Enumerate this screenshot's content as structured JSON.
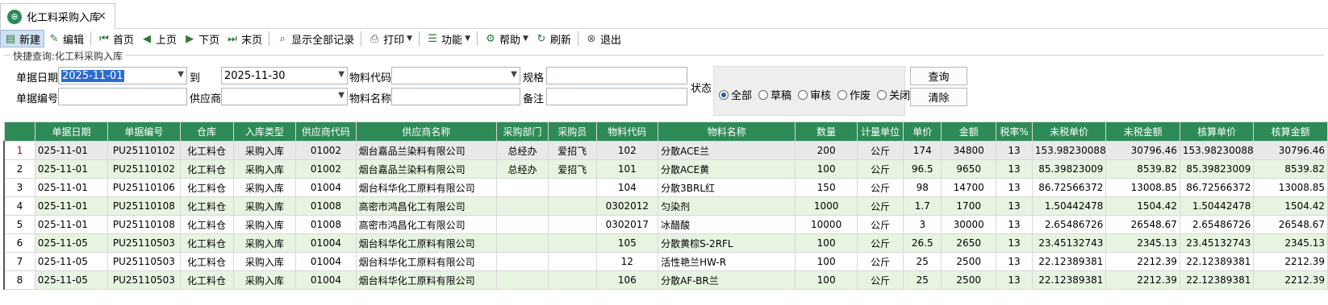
{
  "tab": {
    "title": "化工料采购入库",
    "close": "×"
  },
  "toolbar": {
    "new": "新建",
    "edit": "编辑",
    "first": "首页",
    "prev": "上页",
    "next": "下页",
    "last": "末页",
    "show_all": "显示全部记录",
    "print": "打印",
    "functions": "功能",
    "help": "帮助",
    "refresh": "刷新",
    "exit": "退出"
  },
  "query": {
    "group_title": "快捷查询:化工料采购入库",
    "date_label": "单据日期",
    "date_from": "2025-11-01",
    "to_label": "到",
    "date_to": "2025-11-30",
    "material_code_label": "物料代码",
    "spec_label": "规格",
    "doc_no_label": "单据编号",
    "supplier_label": "供应商",
    "material_name_label": "物料名称",
    "remark_label": "备注",
    "status_label": "状态",
    "status_options": [
      "全部",
      "草稿",
      "审核",
      "作废",
      "关闭"
    ],
    "status_selected": "全部",
    "query_button": "查询",
    "clear_button": "清除"
  },
  "grid": {
    "columns": [
      "单据日期",
      "单据编号",
      "仓库",
      "入库类型",
      "供应商代码",
      "供应商名称",
      "采购部门",
      "采购员",
      "物料代码",
      "物料名称",
      "数量",
      "计量单位",
      "单价",
      "金额",
      "税率%",
      "未税单价",
      "未税金额",
      "核算单价",
      "核算金额"
    ],
    "rows": [
      {
        "n": "1",
        "cells": [
          "025-11-01",
          "PU25110102",
          "化工料仓",
          "采购入库",
          "01002",
          "烟台嘉品兰染料有限公司",
          "总经办",
          "爱招飞",
          "102",
          "分散ACE兰",
          "200",
          "公斤",
          "174",
          "34800",
          "13",
          "153.98230088",
          "30796.46",
          "153.98230088",
          "30796.46"
        ]
      },
      {
        "n": "2",
        "cells": [
          "025-11-01",
          "PU25110102",
          "化工料仓",
          "采购入库",
          "01002",
          "烟台嘉品兰染料有限公司",
          "总经办",
          "爱招飞",
          "101",
          "分散ACE黄",
          "100",
          "公斤",
          "96.5",
          "9650",
          "13",
          "85.39823009",
          "8539.82",
          "85.39823009",
          "8539.82"
        ]
      },
      {
        "n": "3",
        "cells": [
          "025-11-01",
          "PU25110106",
          "化工料仓",
          "采购入库",
          "01004",
          "烟台科华化工原料有限公司",
          "",
          "",
          "104",
          "分散3BRL红",
          "150",
          "公斤",
          "98",
          "14700",
          "13",
          "86.72566372",
          "13008.85",
          "86.72566372",
          "13008.85"
        ]
      },
      {
        "n": "4",
        "cells": [
          "025-11-01",
          "PU25110108",
          "化工料仓",
          "采购入库",
          "01008",
          "高密市鸿昌化工有限公司",
          "",
          "",
          "0302012",
          "匀染剂",
          "1000",
          "公斤",
          "1.7",
          "1700",
          "13",
          "1.50442478",
          "1504.42",
          "1.50442478",
          "1504.42"
        ]
      },
      {
        "n": "5",
        "cells": [
          "025-11-01",
          "PU25110108",
          "化工料仓",
          "采购入库",
          "01008",
          "高密市鸿昌化工有限公司",
          "",
          "",
          "0302017",
          "冰醋酸",
          "10000",
          "公斤",
          "3",
          "30000",
          "13",
          "2.65486726",
          "26548.67",
          "2.65486726",
          "26548.67"
        ]
      },
      {
        "n": "6",
        "cells": [
          "025-11-05",
          "PU25110503",
          "化工料仓",
          "采购入库",
          "01004",
          "烟台科华化工原料有限公司",
          "",
          "",
          "105",
          "分散黄棕S-2RFL",
          "100",
          "公斤",
          "26.5",
          "2650",
          "13",
          "23.45132743",
          "2345.13",
          "23.45132743",
          "2345.13"
        ]
      },
      {
        "n": "7",
        "cells": [
          "025-11-05",
          "PU25110503",
          "化工料仓",
          "采购入库",
          "01004",
          "烟台科华化工原料有限公司",
          "",
          "",
          "12",
          "活性艳兰HW-R",
          "100",
          "公斤",
          "25",
          "2500",
          "13",
          "22.12389381",
          "2212.39",
          "22.12389381",
          "2212.39"
        ]
      },
      {
        "n": "8",
        "cells": [
          "025-11-05",
          "PU25110503",
          "化工料仓",
          "采购入库",
          "01004",
          "烟台科华化工原料有限公司",
          "",
          "",
          "106",
          "分散AF-BR兰",
          "100",
          "公斤",
          "25",
          "2500",
          "13",
          "22.12389381",
          "2212.39",
          "22.12389381",
          "2212.39"
        ]
      }
    ]
  },
  "colors": {
    "header_green": "#2e8b57",
    "row_alt": "#e8f4e2",
    "current_row": "#e9e9e9",
    "current_row_number": "#d00000"
  }
}
